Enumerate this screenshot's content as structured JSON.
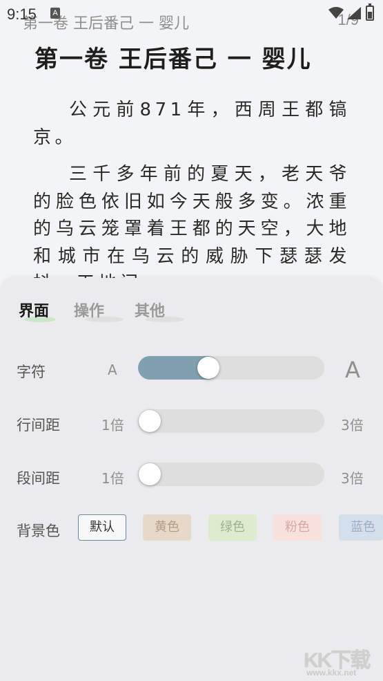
{
  "status_bar": {
    "time": "9:15",
    "notification_icon": "A",
    "icons": [
      "wifi-icon",
      "signal-icon",
      "battery-icon"
    ]
  },
  "header": {
    "chapter": "第一卷 王后番己 一 婴儿",
    "page": "1/9"
  },
  "content": {
    "title": "第一卷 王后番己 一 婴儿",
    "paragraphs": [
      "公元前871年，西周王都镐京。",
      "三千多年前的夏天，老天爷的脸色依旧如今天般多变。浓重的乌云笼罩着王都的天空，大地和城市在乌云的威胁下瑟瑟发抖。天地间"
    ]
  },
  "settings": {
    "tabs": [
      {
        "label": "界面",
        "active": true
      },
      {
        "label": "操作",
        "active": false
      },
      {
        "label": "其他",
        "active": false
      }
    ],
    "font_size": {
      "label": "字符",
      "min": "A",
      "max": "A",
      "value": 0.36
    },
    "line_spacing": {
      "label": "行间距",
      "min": "1倍",
      "max": "3倍",
      "value": 0.0
    },
    "paragraph_spacing": {
      "label": "段间距",
      "min": "1倍",
      "max": "3倍",
      "value": 0.0
    },
    "background": {
      "label": "背景色",
      "options": [
        {
          "label": "默认",
          "color": "#f8f8f8",
          "selected": true
        },
        {
          "label": "黄色",
          "color": "#e7d9c8"
        },
        {
          "label": "绿色",
          "color": "#ddeccf"
        },
        {
          "label": "粉色",
          "color": "#f8e0dc"
        },
        {
          "label": "蓝色",
          "color": "#d3dfea"
        }
      ]
    }
  },
  "colors": {
    "slider_fill": "#80a0b0",
    "active_tab_accent": "#c4e5c3"
  },
  "watermark": {
    "logo": "KK下载",
    "url": "www.kkx.net"
  }
}
